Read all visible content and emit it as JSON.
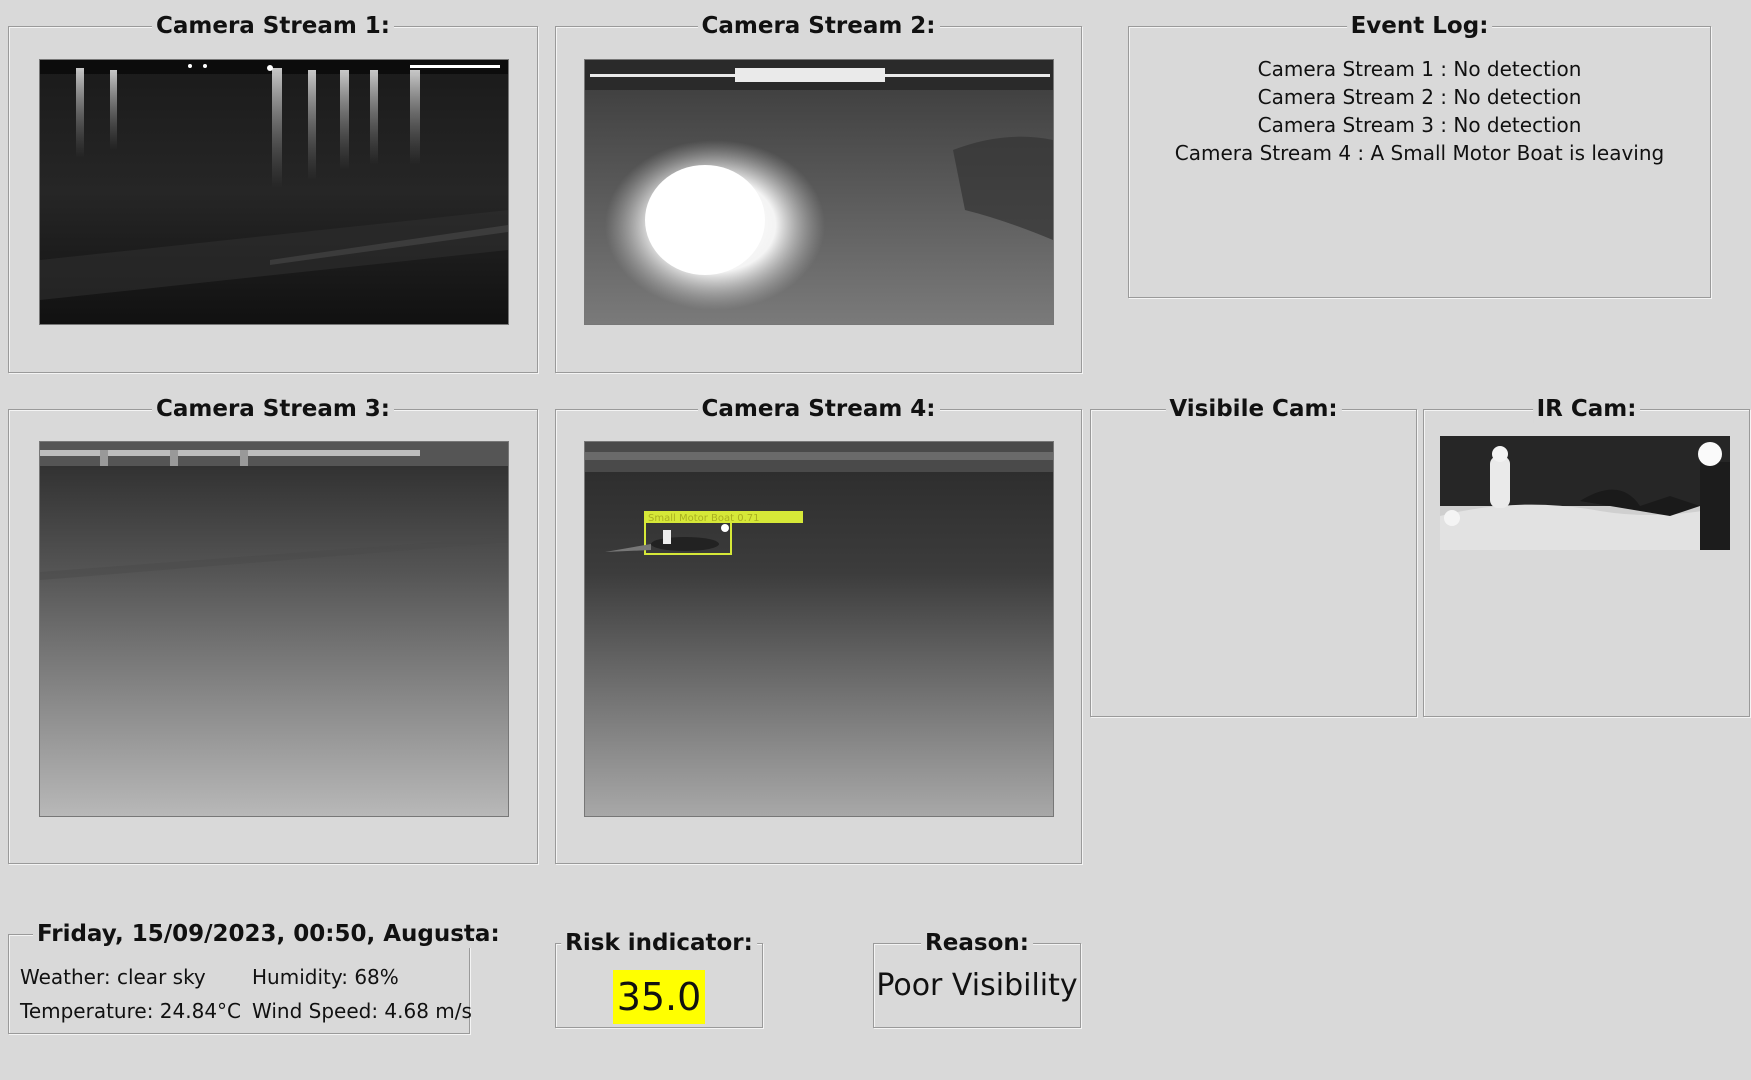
{
  "streams": [
    {
      "title": "Camera Stream 1:"
    },
    {
      "title": "Camera Stream 2:"
    },
    {
      "title": "Camera Stream 3:"
    },
    {
      "title": "Camera Stream 4:"
    }
  ],
  "event_log": {
    "title": "Event Log:",
    "lines": [
      "Camera Stream 1 : No detection",
      "Camera Stream 2 : No detection",
      "Camera Stream 3 : No detection",
      "Camera Stream 4 : A Small Motor Boat is leaving"
    ]
  },
  "detection": {
    "label": "Small Motor Boat 0.71",
    "color": "#d6e838"
  },
  "visible_cam": {
    "title": "Visibile Cam:"
  },
  "ir_cam": {
    "title": "IR Cam:"
  },
  "info": {
    "header": "Friday, 15/09/2023, 00:50, Augusta:",
    "weather": "Weather: clear sky",
    "humidity": "Humidity: 68%",
    "temperature": "Temperature: 24.84°C",
    "wind": "Wind Speed: 4.68 m/s"
  },
  "risk": {
    "title": "Risk indicator:",
    "value": "35.0",
    "color": "#ffff00"
  },
  "reason": {
    "title": "Reason:",
    "value": "Poor Visibility"
  }
}
